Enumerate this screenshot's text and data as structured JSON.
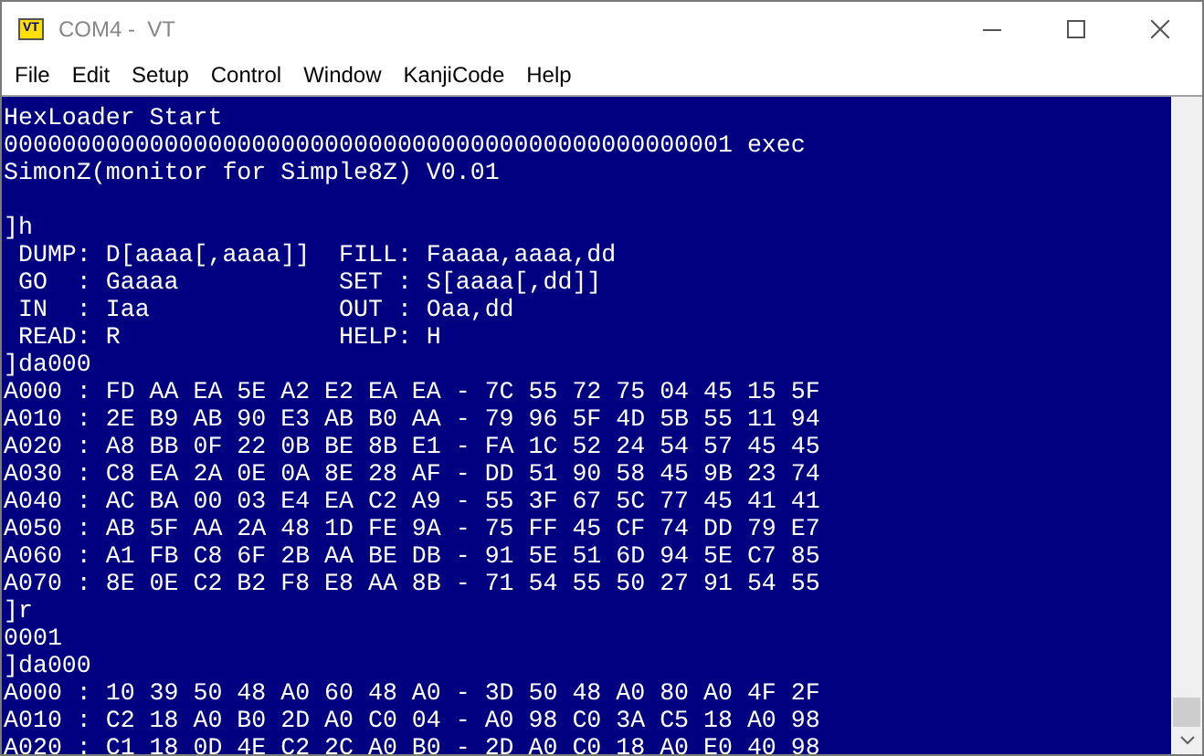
{
  "window": {
    "icon_text": "VT",
    "title": "COM4 -  VT"
  },
  "menu": [
    "File",
    "Edit",
    "Setup",
    "Control",
    "Window",
    "KanjiCode",
    "Help"
  ],
  "terminal": {
    "lines": [
      {
        "kind": "text",
        "text": "HexLoader Start"
      },
      {
        "kind": "text",
        "text": "00000000000000000000000000000000000000000000000001 exec"
      },
      {
        "kind": "text",
        "text": "SimonZ(monitor for Simple8Z) V0.01"
      },
      {
        "kind": "blank"
      },
      {
        "kind": "text",
        "text": "]h"
      },
      {
        "kind": "text",
        "text": " DUMP: D[aaaa[,aaaa]]  FILL: Faaaa,aaaa,dd"
      },
      {
        "kind": "text",
        "text": " GO  : Gaaaa           SET : S[aaaa[,dd]]"
      },
      {
        "kind": "text",
        "text": " IN  : Iaa             OUT : Oaa,dd"
      },
      {
        "kind": "text",
        "text": " READ: R               HELP: H"
      },
      {
        "kind": "text",
        "text": "]da000"
      },
      {
        "kind": "text",
        "text": "A000 : FD AA EA 5E A2 E2 EA EA - 7C 55 72 75 04 45 15 5F"
      },
      {
        "kind": "text",
        "text": "A010 : 2E B9 AB 90 E3 AB B0 AA - 79 96 5F 4D 5B 55 11 94"
      },
      {
        "kind": "text",
        "text": "A020 : A8 BB 0F 22 0B BE 8B E1 - FA 1C 52 24 54 57 45 45"
      },
      {
        "kind": "text",
        "text": "A030 : C8 EA 2A 0E 0A 8E 28 AF - DD 51 90 58 45 9B 23 74"
      },
      {
        "kind": "text",
        "text": "A040 : AC BA 00 03 E4 EA C2 A9 - 55 3F 67 5C 77 45 41 41"
      },
      {
        "kind": "text",
        "text": "A050 : AB 5F AA 2A 48 1D FE 9A - 75 FF 45 CF 74 DD 79 E7"
      },
      {
        "kind": "text",
        "text": "A060 : A1 FB C8 6F 2B AA BE DB - 91 5E 51 6D 94 5E C7 85"
      },
      {
        "kind": "text",
        "text": "A070 : 8E 0E C2 B2 F8 E8 AA 8B - 71 54 55 50 27 91 54 55"
      },
      {
        "kind": "text",
        "text": "]r"
      },
      {
        "kind": "text",
        "text": "0001"
      },
      {
        "kind": "text",
        "text": "]da000"
      },
      {
        "kind": "text",
        "text": "A000 : 10 39 50 48 A0 60 48 A0 - 3D 50 48 A0 80 A0 4F 2F"
      },
      {
        "kind": "text",
        "text": "A010 : C2 18 A0 B0 2D A0 C0 04 - A0 98 C0 3A C5 18 A0 98"
      },
      {
        "kind": "text",
        "text": "A020 : C1 18 0D 4E C2 2C A0 B0 - 2D A0 C0 18 A0 E0 40 98"
      }
    ]
  }
}
